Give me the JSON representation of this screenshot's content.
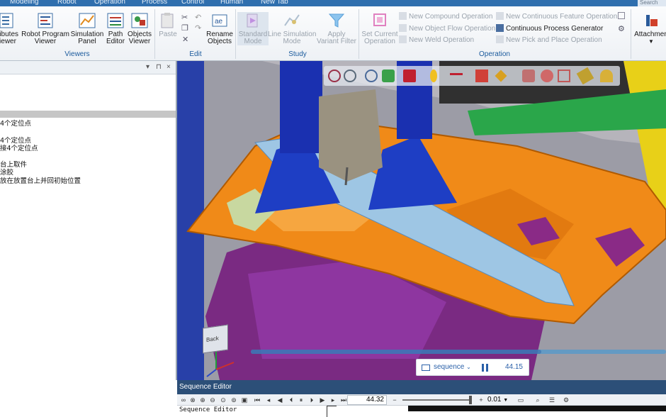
{
  "menu": {
    "items": [
      "Modeling",
      "Robot",
      "Operation",
      "Process",
      "Control",
      "Human",
      "New Tab"
    ],
    "search": "Search"
  },
  "ribbon": {
    "viewers": {
      "label": "Viewers",
      "buttons": [
        {
          "line1": "ributes",
          "line2": "iewer",
          "icon": "attributes-viewer-icon"
        },
        {
          "line1": "Robot Program",
          "line2": "Viewer",
          "icon": "robot-program-icon"
        },
        {
          "line1": "Simulation",
          "line2": "Panel",
          "icon": "simulation-panel-icon"
        },
        {
          "line1": "Path",
          "line2": "Editor",
          "icon": "path-editor-icon"
        },
        {
          "line1": "Objects",
          "line2": "Viewer",
          "icon": "objects-viewer-icon"
        }
      ]
    },
    "edit": {
      "label": "Edit",
      "paste": "Paste",
      "rename_line1": "Rename",
      "rename_line2": "Objects"
    },
    "study": {
      "label": "Study",
      "standard_line1": "Standard",
      "standard_line2": "Mode",
      "line_sim_line1": "Line Simulation",
      "line_sim_line2": "Mode",
      "apply_line1": "Apply",
      "apply_line2": "Variant Filter"
    },
    "operation": {
      "label": "Operation",
      "set_current_line1": "Set Current",
      "set_current_line2": "Operation",
      "col1": [
        "New Compound Operation",
        "New Object Flow Operation",
        "New Weld Operation"
      ],
      "col2": [
        "New Continuous Feature Operation",
        "Continuous Process Generator",
        "New Pick and Place Operation"
      ]
    },
    "attachment": "Attachmen"
  },
  "left_panel": {
    "tree": [
      "4个定位点",
      "",
      "4个定位点",
      "接4个定位点",
      "",
      "台上取件",
      "涂胶",
      "放在放置台上并回初始位置"
    ]
  },
  "viewport": {
    "cube_label": "Back",
    "sequence_label": "sequence",
    "sequence_time": "44.15"
  },
  "sequence_editor": {
    "title": "Sequence Editor",
    "time": "44.32",
    "step": "0.01",
    "body_label": "Sequence Editor"
  }
}
